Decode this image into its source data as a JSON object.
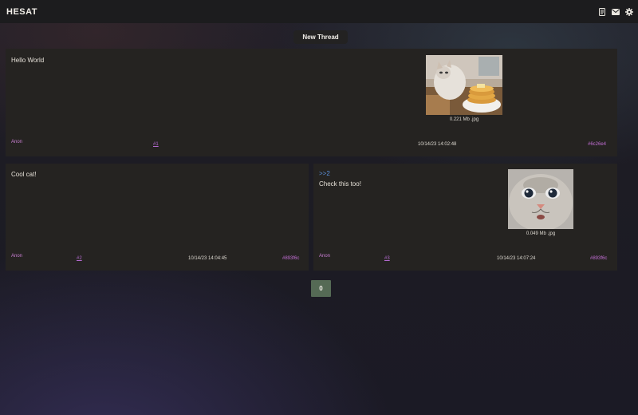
{
  "header": {
    "brand": "HESAT",
    "icons": [
      "document-icon",
      "mail-icon",
      "gear-icon"
    ]
  },
  "new_thread_label": "New Thread",
  "posts": [
    {
      "text": "Hello World",
      "author": "Anon",
      "number": "#1",
      "timestamp": "10/14/23 14:02:48",
      "hash": "#6c26e4",
      "image_caption": "0.221 Mb .jpg"
    },
    {
      "text": "Cool cat!",
      "author": "Anon",
      "number": "#2",
      "timestamp": "10/14/23 14:04:45",
      "hash": "#893f6c"
    },
    {
      "quote": ">>2",
      "text": "Check this too!",
      "author": "Anon",
      "number": "#3",
      "timestamp": "10/14/23 14:07:24",
      "hash": "#893f6c",
      "image_caption": "0.049 Mb .jpg"
    }
  ],
  "pagination": {
    "current": "0"
  },
  "colors": {
    "card_bg": "#252321",
    "link_purple": "#b46ad0",
    "quote_blue": "#5a8fd8",
    "page_button": "#556a55"
  }
}
